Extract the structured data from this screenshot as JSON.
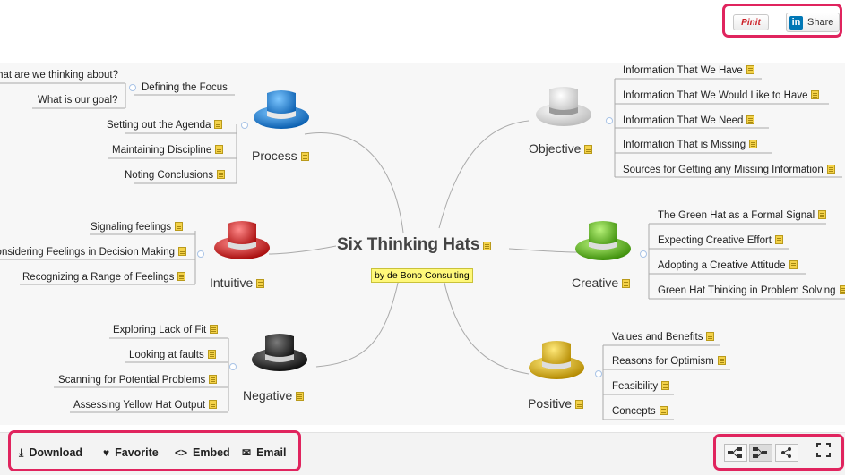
{
  "share": {
    "pinit_label": "Pinit",
    "linkedin_logo": "in",
    "linkedin_label": "Share"
  },
  "map": {
    "central_title": "Six Thinking Hats",
    "subtitle": "by de Bono Consulting",
    "colors": {
      "process": "#1e88d8",
      "objective": "#e6e6e6",
      "intuitive": "#e02020",
      "creative": "#66c21a",
      "negative": "#2a2a2a",
      "positive": "#e3b90c",
      "connector": "#aaaaaa",
      "note": "#f4d24a",
      "highlight": "#fff87a"
    },
    "branches": {
      "process": {
        "label": "Process",
        "defining_focus": "Defining the Focus",
        "focus_children": [
          "What are we thinking about?",
          "What is our goal?"
        ],
        "children": [
          "Setting out the Agenda",
          "Maintaining Discipline",
          "Noting Conclusions"
        ]
      },
      "intuitive": {
        "label": "Intuitive",
        "children": [
          "Signaling feelings",
          "Considering Feelings in Decision Making",
          "Recognizing a Range of Feelings"
        ]
      },
      "negative": {
        "label": "Negative",
        "children": [
          "Exploring Lack of Fit",
          "Looking at faults",
          "Scanning for Potential Problems",
          "Assessing Yellow Hat Output"
        ]
      },
      "objective": {
        "label": "Objective",
        "children": [
          "Information That We Have",
          "Information That We Would Like to Have",
          "Information That We Need",
          "Information That is Missing",
          "Sources for Getting any Missing Information"
        ]
      },
      "creative": {
        "label": "Creative",
        "children": [
          "The Green Hat as a Formal Signal",
          "Expecting Creative Effort",
          "Adopting a Creative Attitude",
          "Green Hat Thinking in Problem Solving"
        ]
      },
      "positive": {
        "label": "Positive",
        "children": [
          "Values and Benefits",
          "Reasons for Optimism",
          "Feasibility",
          "Concepts"
        ]
      }
    }
  },
  "toolbar": {
    "download": "Download",
    "favorite": "Favorite",
    "embed": "Embed",
    "email": "Email",
    "download_icon": "download-icon",
    "favorite_icon": "heart-icon",
    "embed_icon": "code-icon",
    "email_icon": "envelope-icon",
    "fullscreen_icon": "fullscreen-icon",
    "accent": "#e0245e"
  }
}
